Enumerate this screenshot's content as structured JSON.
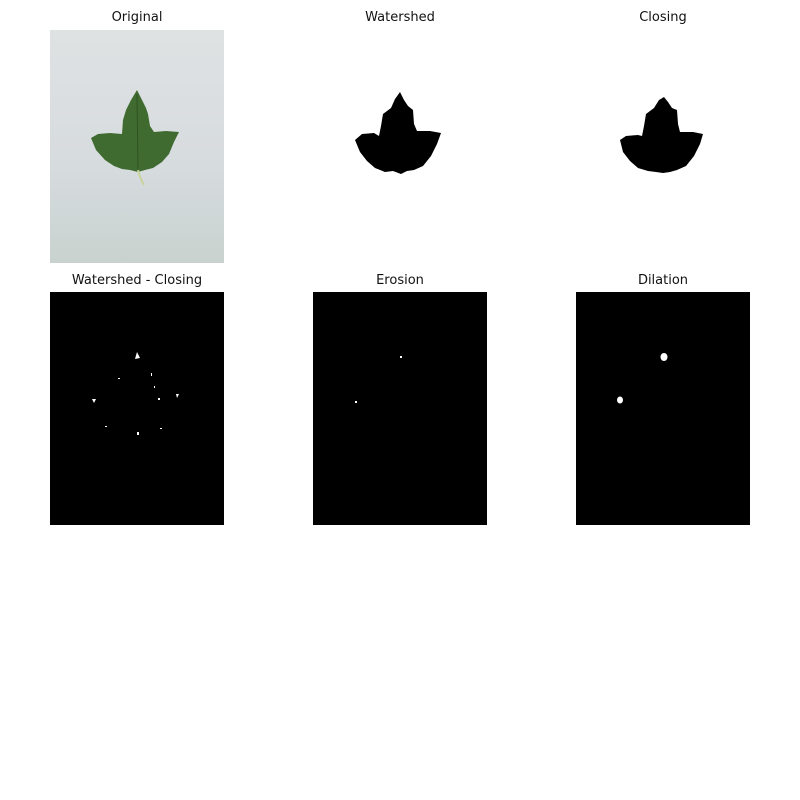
{
  "figure": {
    "background": "#ffffff",
    "panels": [
      {
        "title": "Original",
        "kind": "photo"
      },
      {
        "title": "Watershed",
        "kind": "mask"
      },
      {
        "title": "Closing",
        "kind": "mask"
      },
      {
        "title": "Watershed - Closing",
        "kind": "residual"
      },
      {
        "title": "Erosion",
        "kind": "residual"
      },
      {
        "title": "Dilation",
        "kind": "residual"
      }
    ]
  },
  "colors": {
    "paper": "#d9dde0",
    "leaf": "#3f6b30",
    "leaf_vein": "#c9d39c",
    "mask_fg": "#000000",
    "mask_bg": "#ffffff",
    "residual_bg": "#000000",
    "residual_fg": "#ffffff"
  }
}
